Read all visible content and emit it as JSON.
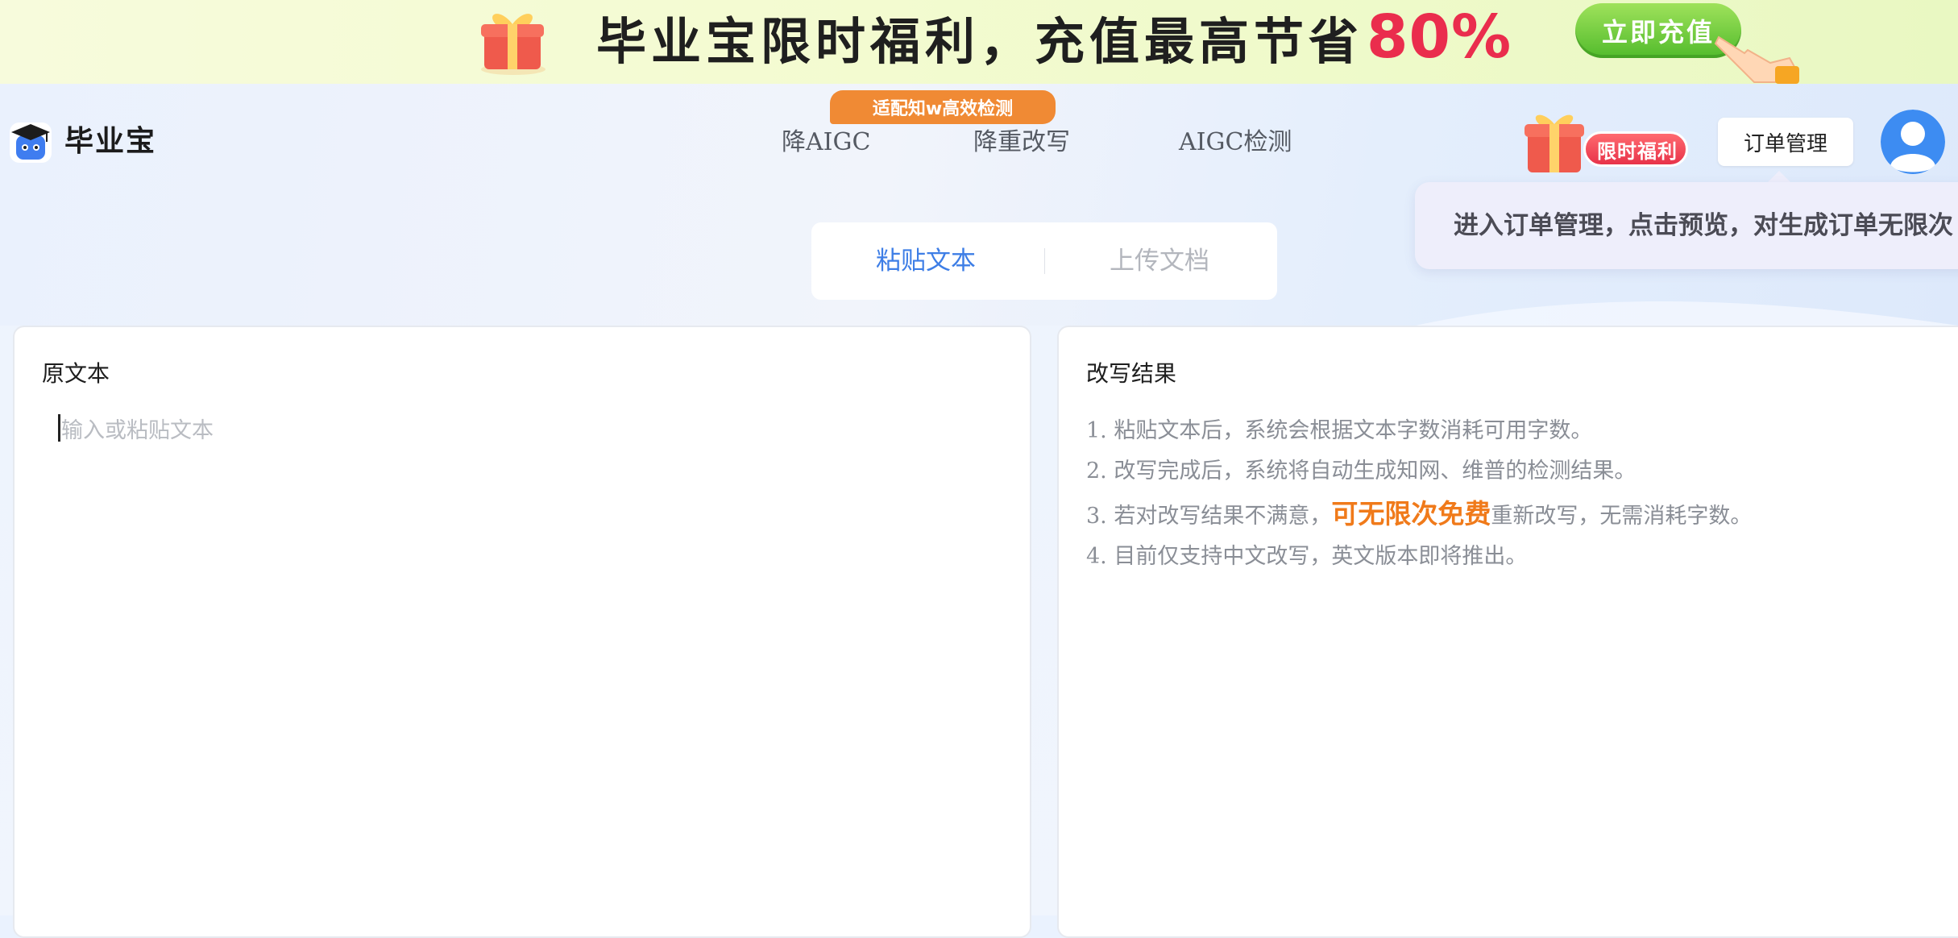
{
  "promo": {
    "title": "毕业宝限时福利，充值最高节省",
    "percent": "80%",
    "button": "立即充值"
  },
  "header": {
    "brand": "毕业宝",
    "nav_badge": "适配知w高效检测",
    "nav": [
      "降AIGC",
      "降重改写",
      "AIGC检测"
    ],
    "gift_label": "限时福利",
    "order_button": "订单管理",
    "tooltip": "进入订单管理，点击预览，对生成订单无限次"
  },
  "tabs": {
    "paste": "粘贴文本",
    "upload": "上传文档"
  },
  "left_panel": {
    "title": "原文本",
    "placeholder": "输入或粘贴文本"
  },
  "right_panel": {
    "title": "改写结果",
    "tips": {
      "t1": "1. 粘贴文本后，系统会根据文本字数消耗可用字数。",
      "t2": "2. 改写完成后，系统将自动生成知网、维普的检测结果。",
      "t3_before": "3. 若对改写结果不满意，",
      "t3_highlight": "可无限次免费",
      "t3_after": "重新改写，无需消耗字数。",
      "t4": "4. 目前仅支持中文改写，英文版本即将推出。"
    }
  },
  "colors": {
    "accent_blue": "#3e7ee6",
    "highlight_orange": "#f07a1a",
    "promo_red": "#ea2d4d",
    "promo_green": "#52bb2c",
    "badge_orange": "#f08a34"
  },
  "icons": {
    "logo": "graduation-cap-mascot-icon",
    "promo_gift": "gift-box-icon",
    "promo_hand": "pointing-hand-icon",
    "avatar": "user-avatar-icon"
  }
}
